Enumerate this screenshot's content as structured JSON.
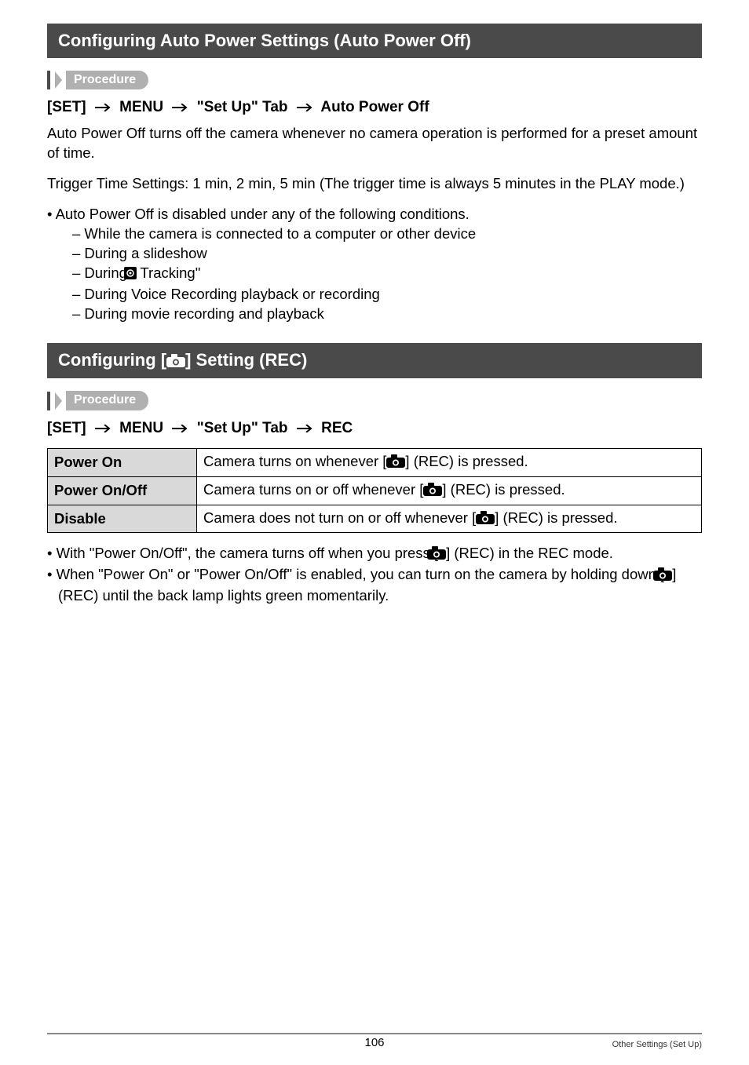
{
  "section1": {
    "title": "Configuring Auto Power Settings (Auto Power Off)",
    "procedure_label": "Procedure",
    "path": {
      "p1": "[SET]",
      "p2": "MENU",
      "p3": "\"Set Up\" Tab",
      "p4": "Auto Power Off"
    },
    "body1": "Auto Power Off turns off the camera whenever no camera operation is performed for a preset amount of time.",
    "body2": "Trigger Time Settings: 1 min, 2 min, 5 min (The trigger time is always 5 minutes in the PLAY mode.)",
    "b1": "• Auto Power Off is disabled under any of the following conditions.",
    "b1a": "– While the camera is connected to a computer or other device",
    "b1b": "– During a slideshow",
    "b1c_pre": "– During \"",
    "b1c_post": " Tracking\"",
    "b1d": "– During Voice Recording playback or recording",
    "b1e": "– During movie recording and playback"
  },
  "section2": {
    "title_pre": "Configuring [",
    "title_post": "] Setting (REC)",
    "procedure_label": "Procedure",
    "path": {
      "p1": "[SET]",
      "p2": "MENU",
      "p3": "\"Set Up\" Tab",
      "p4": "REC"
    },
    "table": {
      "r1": {
        "label": "Power On",
        "pre": "Camera turns on whenever [",
        "post": "] (REC) is pressed."
      },
      "r2": {
        "label": "Power On/Off",
        "pre": "Camera turns on or off whenever [",
        "post": "] (REC) is pressed."
      },
      "r3": {
        "label": "Disable",
        "pre": "Camera does not turn on or off whenever [",
        "post": "] (REC) is pressed."
      }
    },
    "note1_pre": "• With \"Power On/Off\", the camera turns off when you press [",
    "note1_post": "] (REC) in the REC mode.",
    "note2_pre": "• When \"Power On\" or \"Power On/Off\" is enabled, you can turn on the camera by holding down [",
    "note2_post": "] (REC) until the back lamp lights green momentarily."
  },
  "footer": {
    "page": "106",
    "section": "Other Settings (Set Up)"
  }
}
